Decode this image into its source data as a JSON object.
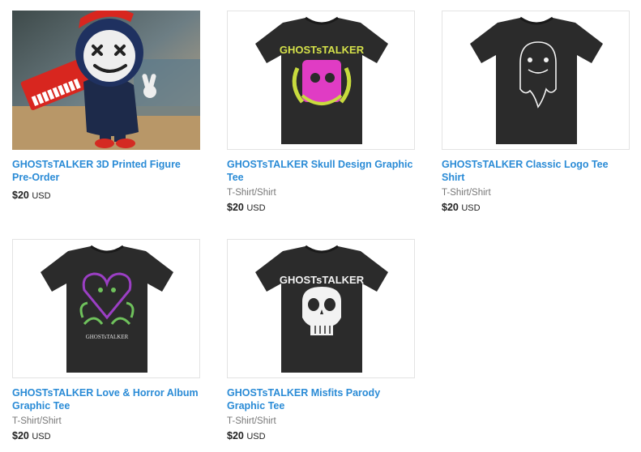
{
  "products": [
    {
      "title": "GHOSTsTALKER 3D Printed Figure Pre-Order",
      "category": "",
      "price": "$20",
      "currency": "USD",
      "image": "figure-photo"
    },
    {
      "title": "GHOSTsTALKER Skull Design Graphic Tee",
      "category": "T-Shirt/Shirt",
      "price": "$20",
      "currency": "USD",
      "image": "skull-design-tee",
      "print_text": "GHOSTsTALKER"
    },
    {
      "title": "GHOSTsTALKER Classic Logo Tee Shirt",
      "category": "T-Shirt/Shirt",
      "price": "$20",
      "currency": "USD",
      "image": "classic-logo-tee"
    },
    {
      "title": "GHOSTsTALKER Love & Horror Album Graphic Tee",
      "category": "T-Shirt/Shirt",
      "price": "$20",
      "currency": "USD",
      "image": "love-horror-tee",
      "print_text": "GHOSTsTALKER"
    },
    {
      "title": "GHOSTsTALKER Misfits Parody Graphic Tee",
      "category": "T-Shirt/Shirt",
      "price": "$20",
      "currency": "USD",
      "image": "misfits-parody-tee",
      "print_text": "GHOSTsTALKER"
    }
  ]
}
